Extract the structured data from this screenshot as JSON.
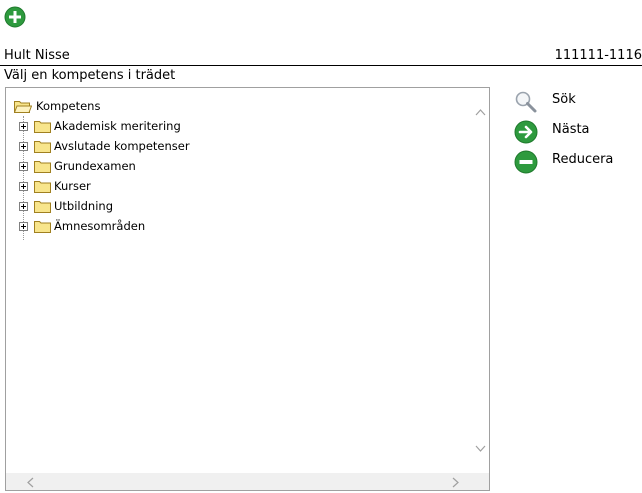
{
  "colors": {
    "accent_green": "#2e9a3e",
    "border": "#a0a0a0",
    "folder_fill": "#f8e58c"
  },
  "toolbar": {
    "add_icon": "plus-circle-icon"
  },
  "header": {
    "name": "Hult Nisse",
    "id": "111111-1116"
  },
  "subtitle": "Välj en kompetens i trädet",
  "tree": {
    "root": "Kompetens",
    "children": [
      {
        "label": "Akademisk meritering"
      },
      {
        "label": "Avslutade kompetenser"
      },
      {
        "label": "Grundexamen"
      },
      {
        "label": "Kurser"
      },
      {
        "label": "Utbildning"
      },
      {
        "label": "Ämnesområden"
      }
    ]
  },
  "actions": {
    "search": {
      "label": "Sök",
      "icon": "magnifier-icon"
    },
    "next": {
      "label": "Nästa",
      "icon": "arrow-right-circle-icon"
    },
    "reduce": {
      "label": "Reducera",
      "icon": "minus-circle-icon"
    }
  }
}
